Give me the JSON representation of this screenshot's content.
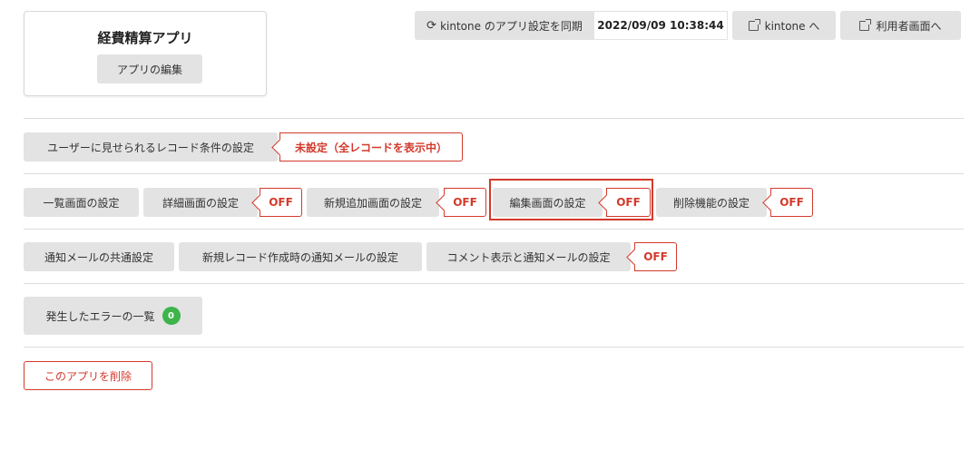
{
  "app": {
    "title": "経費精算アプリ",
    "edit_label": "アプリの編集"
  },
  "header": {
    "sync_label": "kintone のアプリ設定を同期",
    "sync_timestamp": "2022/09/09 10:38:44",
    "kintone_link": "kintone へ",
    "user_screen_link": "利用者画面へ"
  },
  "conditions": {
    "label": "ユーザーに見せられるレコード条件の設定",
    "status": "未設定（全レコードを表示中）"
  },
  "screens": {
    "list_label": "一覧画面の設定",
    "detail_label": "詳細画面の設定",
    "detail_status": "OFF",
    "add_label": "新規追加画面の設定",
    "add_status": "OFF",
    "edit_label": "編集画面の設定",
    "edit_status": "OFF",
    "delete_label": "削除機能の設定",
    "delete_status": "OFF"
  },
  "notifications": {
    "common_label": "通知メールの共通設定",
    "new_record_label": "新規レコード作成時の通知メールの設定",
    "comment_label": "コメント表示と通知メールの設定",
    "comment_status": "OFF"
  },
  "errors": {
    "label": "発生したエラーの一覧",
    "count": "0"
  },
  "danger": {
    "delete_app_label": "このアプリを削除"
  },
  "colors": {
    "accent_red": "#d33a2c",
    "button_gray": "#e3e3e3",
    "badge_green": "#3db44a"
  }
}
